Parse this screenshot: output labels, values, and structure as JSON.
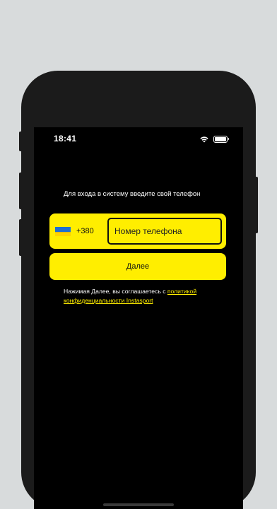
{
  "status_bar": {
    "time": "18:41",
    "icons": [
      "wifi-icon",
      "battery-icon"
    ]
  },
  "login": {
    "prompt": "Для входа в систему введите свой телефон",
    "country_flag": "ukraine-flag-icon",
    "country_code": "+380",
    "phone_placeholder": "Номер телефона",
    "phone_value": "",
    "next_label": "Далее",
    "terms_prefix": "Нажимая Далее, вы соглашаетесь с ",
    "terms_link_part1": "политикой",
    "terms_link_part2": "конфиденциальности Instasport"
  },
  "colors": {
    "accent": "#ffee00",
    "background": "#000000",
    "frame": "#1b1b1b",
    "page_background": "#d8dbdc",
    "flag_blue": "#1f6fd1",
    "flag_yellow": "#ffd400"
  }
}
